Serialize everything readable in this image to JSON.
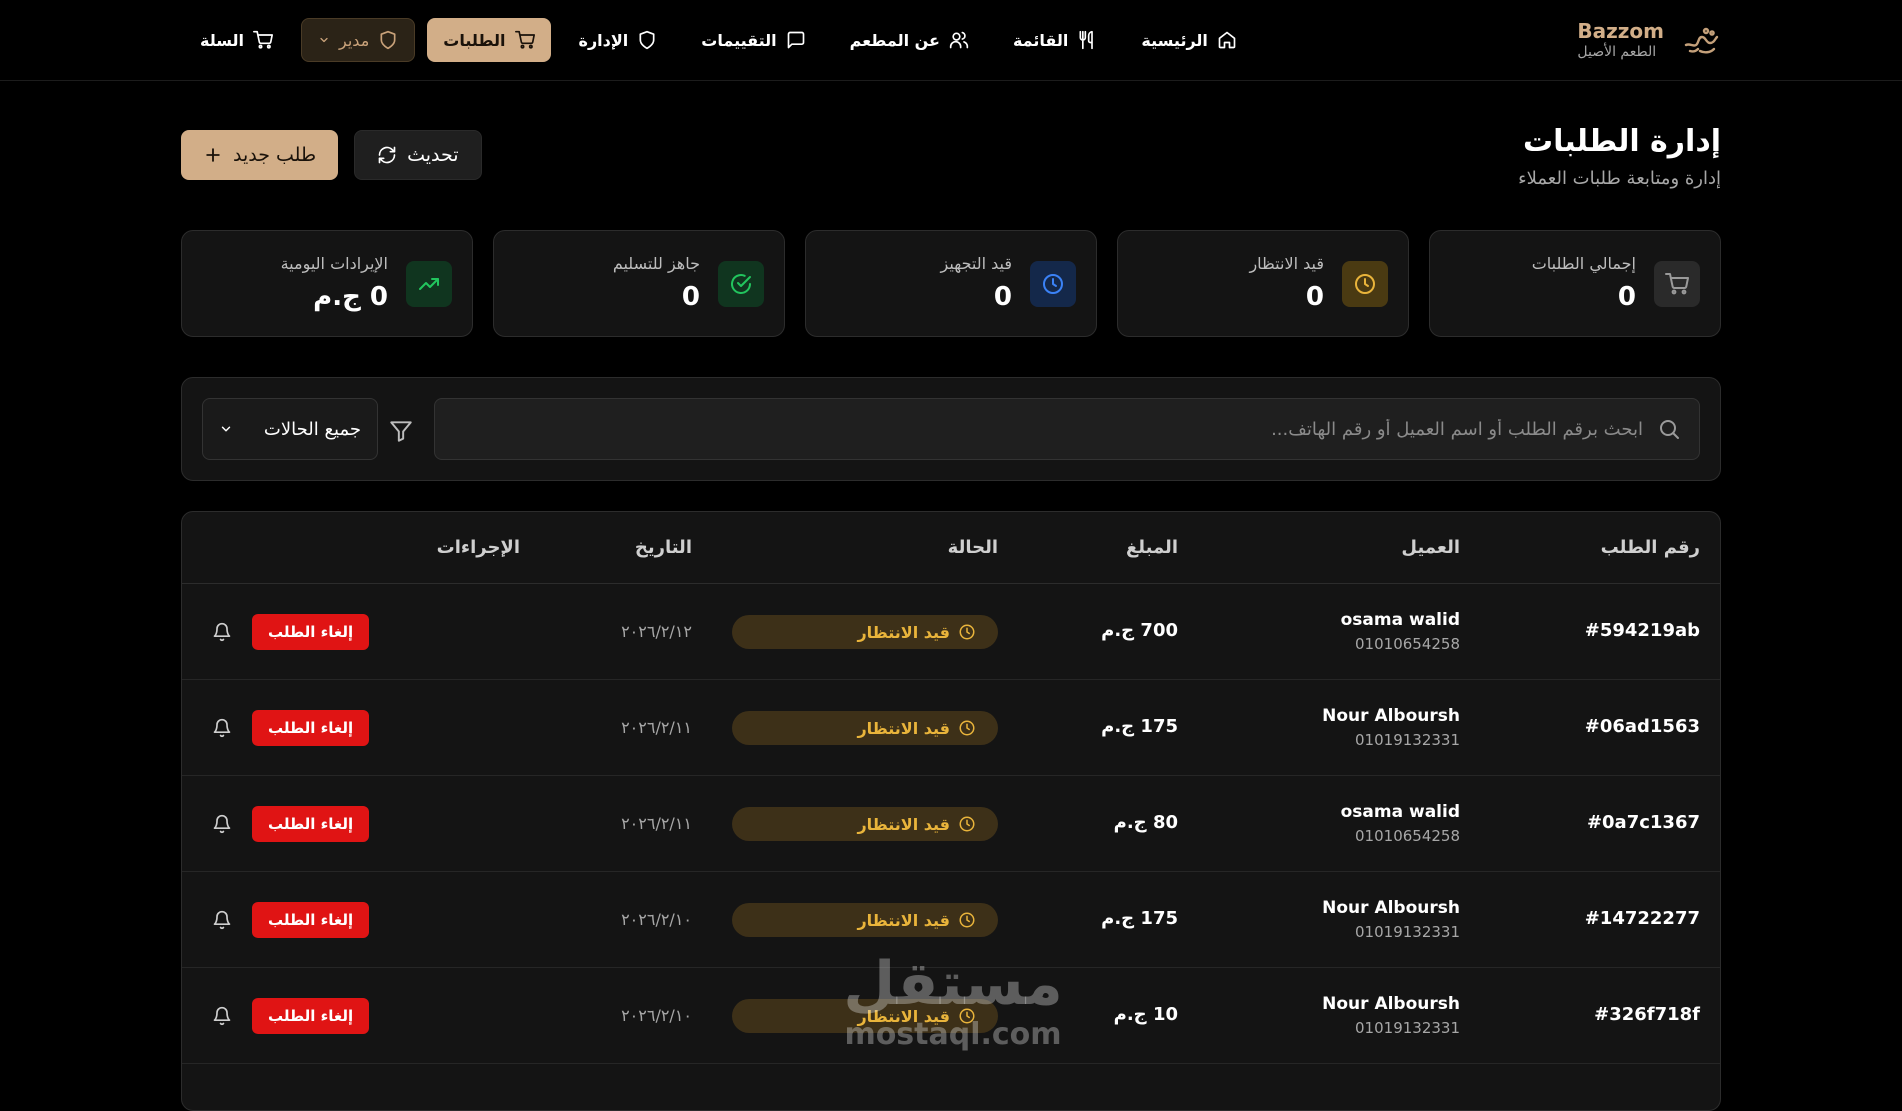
{
  "brand": {
    "name": "Bazzom",
    "tagline": "الطعم الأصيل"
  },
  "nav": {
    "home": "الرئيسية",
    "menu": "القائمة",
    "about": "عن المطعم",
    "reviews": "التقييمات",
    "admin": "الإدارة",
    "orders": "الطلبات",
    "role": "مدير",
    "cart": "السلة"
  },
  "page": {
    "title": "إدارة الطلبات",
    "subtitle": "إدارة ومتابعة طلبات العملاء"
  },
  "actions": {
    "refresh": "تحديث",
    "new_order": "طلب جديد"
  },
  "stats": [
    {
      "label": "إجمالي الطلبات",
      "value": "0",
      "icon": "cart-icon",
      "color": "#9a9a9a"
    },
    {
      "label": "قيد الانتظار",
      "value": "0",
      "icon": "clock-icon",
      "color": "#e9b43b"
    },
    {
      "label": "قيد التجهيز",
      "value": "0",
      "icon": "clock-icon",
      "color": "#3b82f6"
    },
    {
      "label": "جاهز للتسليم",
      "value": "0",
      "icon": "check-circle-icon",
      "color": "#22c55e"
    },
    {
      "label": "الإيرادات اليومية",
      "value": "0 ج.م",
      "icon": "trending-up-icon",
      "color": "#22c55e"
    }
  ],
  "filters": {
    "search_placeholder": "ابحث برقم الطلب أو اسم العميل أو رقم الهاتف...",
    "status_selected": "جميع الحالات"
  },
  "table": {
    "headers": {
      "order_id": "رقم الطلب",
      "customer": "العميل",
      "amount": "المبلغ",
      "status": "الحالة",
      "date": "التاريخ",
      "actions": "الإجراءات"
    },
    "cancel_label": "إلغاء الطلب",
    "rows": [
      {
        "id": "#594219ab",
        "name": "osama walid",
        "phone": "01010654258",
        "amount": "700 ج.م",
        "status": "قيد الانتظار",
        "date": "٢٠٢٦/٢/١٢"
      },
      {
        "id": "#06ad1563",
        "name": "Nour Alboursh",
        "phone": "01019132331",
        "amount": "175 ج.م",
        "status": "قيد الانتظار",
        "date": "٢٠٢٦/٢/١١"
      },
      {
        "id": "#0a7c1367",
        "name": "osama walid",
        "phone": "01010654258",
        "amount": "80 ج.م",
        "status": "قيد الانتظار",
        "date": "٢٠٢٦/٢/١١"
      },
      {
        "id": "#14722277",
        "name": "Nour Alboursh",
        "phone": "01019132331",
        "amount": "175 ج.م",
        "status": "قيد الانتظار",
        "date": "٢٠٢٦/٢/١٠"
      },
      {
        "id": "#326f718f",
        "name": "Nour Alboursh",
        "phone": "01019132331",
        "amount": "10 ج.م",
        "status": "قيد الانتظار",
        "date": "٢٠٢٦/٢/١٠"
      }
    ]
  },
  "watermark": {
    "arabic": "مستقل",
    "latin": "mostaql.com"
  }
}
